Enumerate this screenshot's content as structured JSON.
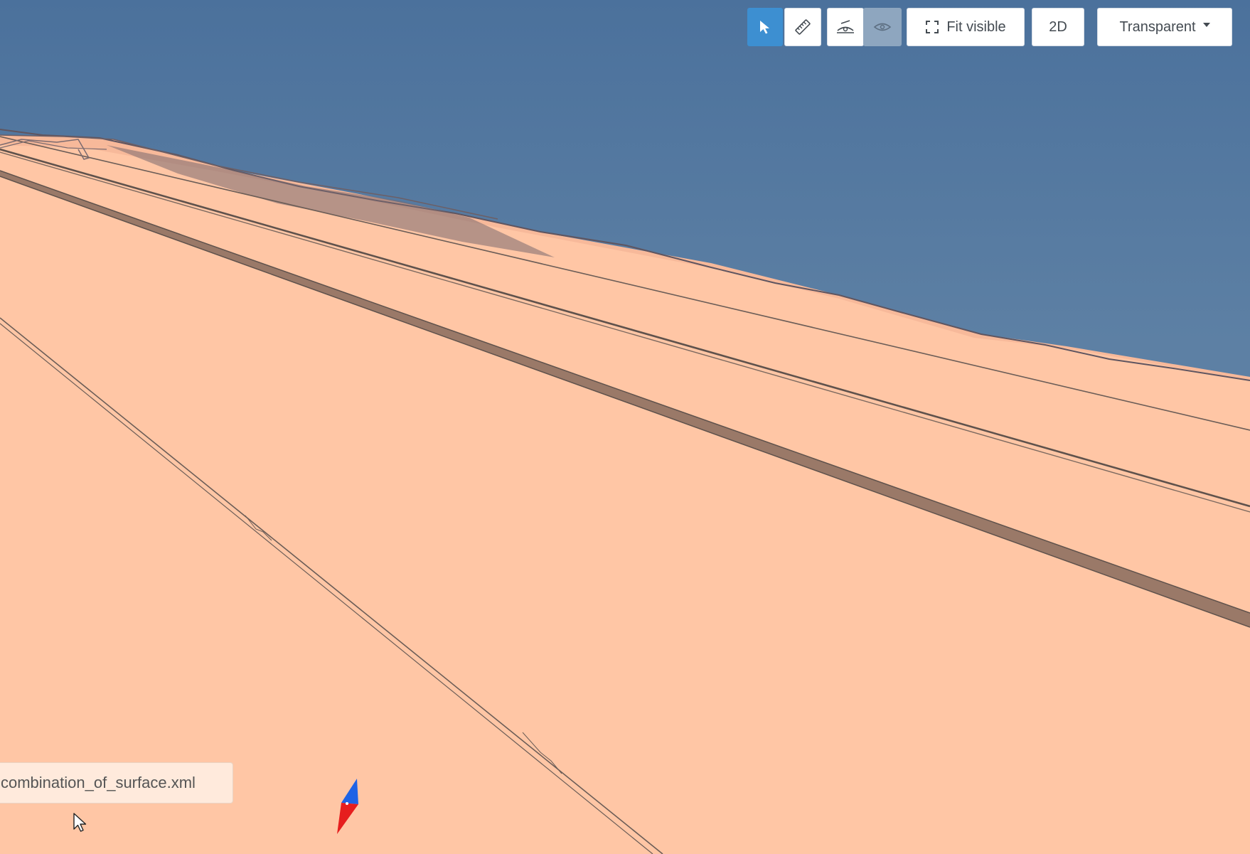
{
  "toolbar": {
    "select_icon": "pointer-arrow-icon",
    "measure_icon": "ruler-icon",
    "view_top_icon": "eye-plane-icon",
    "view_side_icon": "eye-plane-icon",
    "fit_icon": "fit-frame-icon",
    "fit_label": "Fit visible",
    "mode_2d_label": "2D",
    "render_mode_label": "Transparent"
  },
  "file_tag": {
    "label": "combination_of_surface.xml"
  },
  "compass": {
    "north_color": "#1e63e6",
    "south_color": "#e61e1e"
  },
  "colors": {
    "sky_top": "#4d739e",
    "sky_mid": "#5b7fa3",
    "ground": "#ffc6a5",
    "ground_far": "#f7b99a",
    "strip_fill": "#9a7968",
    "line": "#6b5d57",
    "accent": "#3d8fd1"
  }
}
